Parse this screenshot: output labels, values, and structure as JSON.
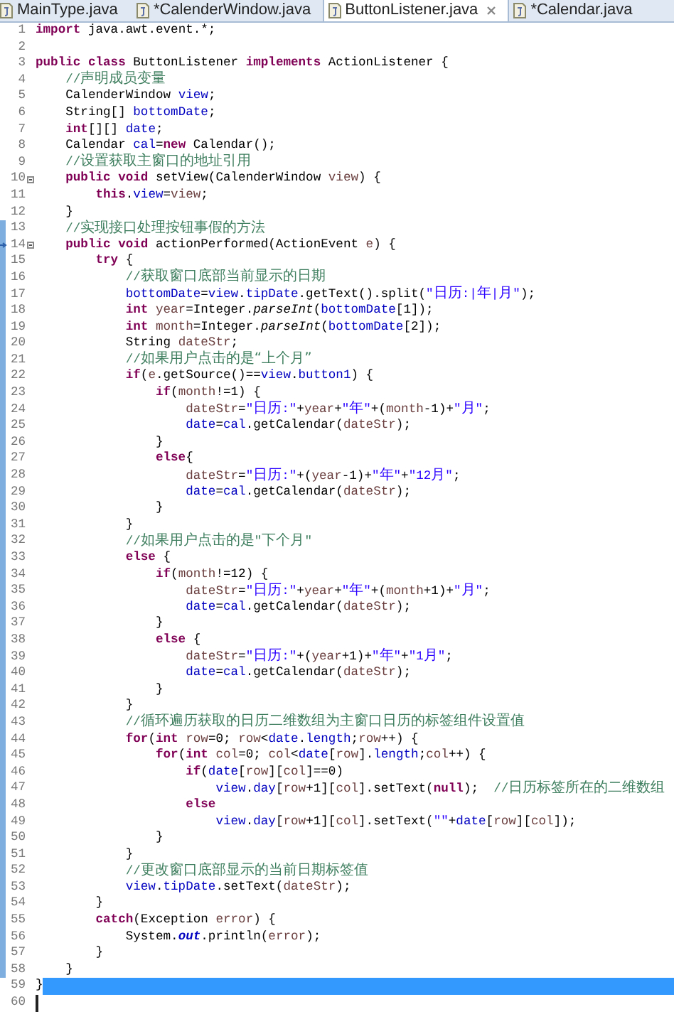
{
  "tabs": [
    {
      "label": "MainType.java",
      "selected": false,
      "closable": false
    },
    {
      "label": "*CalenderWindow.java",
      "selected": false,
      "closable": false
    },
    {
      "label": "ButtonListener.java",
      "selected": true,
      "closable": true
    },
    {
      "label": "*Calendar.java",
      "selected": false,
      "closable": false
    }
  ],
  "lines": [
    {
      "number": "1",
      "kind": "plain",
      "changed": false,
      "selected": false,
      "caret": false,
      "tokens": [
        {
          "kind": "keyword",
          "text": "import"
        },
        {
          "kind": "plain",
          "text": " java.awt.event.*;"
        }
      ]
    },
    {
      "number": "2",
      "kind": "plain",
      "changed": false,
      "selected": false,
      "caret": false
    },
    {
      "number": "3",
      "kind": "plain",
      "changed": false,
      "selected": false,
      "caret": false,
      "tokens": [
        {
          "kind": "keyword",
          "text": "public class"
        },
        {
          "kind": "plain",
          "text": " ButtonListener "
        },
        {
          "kind": "keyword",
          "text": "implements"
        },
        {
          "kind": "plain",
          "text": " ActionListener {"
        }
      ]
    },
    {
      "number": "4",
      "kind": "plain",
      "changed": false,
      "selected": false,
      "caret": false,
      "tokens": [
        {
          "kind": "comment",
          "text": "    //声明成员变量"
        }
      ]
    },
    {
      "number": "5",
      "kind": "plain",
      "changed": false,
      "selected": false,
      "caret": false,
      "tokens": [
        {
          "kind": "plain",
          "text": "    CalenderWindow "
        },
        {
          "kind": "field",
          "text": "view"
        },
        {
          "kind": "plain",
          "text": ";"
        }
      ]
    },
    {
      "number": "6",
      "kind": "plain",
      "changed": false,
      "selected": false,
      "caret": false,
      "tokens": [
        {
          "kind": "plain",
          "text": "    String[] "
        },
        {
          "kind": "field",
          "text": "bottomDate"
        },
        {
          "kind": "plain",
          "text": ";"
        }
      ]
    },
    {
      "number": "7",
      "kind": "plain",
      "changed": false,
      "selected": false,
      "caret": false,
      "tokens": [
        {
          "kind": "keyword",
          "text": "    int"
        },
        {
          "kind": "plain",
          "text": "[][] "
        },
        {
          "kind": "field",
          "text": "date"
        },
        {
          "kind": "plain",
          "text": ";"
        }
      ]
    },
    {
      "number": "8",
      "kind": "plain",
      "changed": false,
      "selected": false,
      "caret": false,
      "tokens": [
        {
          "kind": "plain",
          "text": "    Calendar "
        },
        {
          "kind": "field",
          "text": "cal"
        },
        {
          "kind": "plain",
          "text": "="
        },
        {
          "kind": "keyword",
          "text": "new"
        },
        {
          "kind": "plain",
          "text": " Calendar();"
        }
      ]
    },
    {
      "number": "9",
      "kind": "plain",
      "changed": false,
      "selected": false,
      "caret": false,
      "tokens": [
        {
          "kind": "comment",
          "text": "    //设置获取主窗口的地址引用"
        }
      ]
    },
    {
      "number": "10",
      "kind": "foldable",
      "changed": false,
      "selected": false,
      "caret": false,
      "tokens": [
        {
          "kind": "keyword",
          "text": "    public void"
        },
        {
          "kind": "plain",
          "text": " setView(CalenderWindow "
        },
        {
          "kind": "local",
          "text": "view"
        },
        {
          "kind": "plain",
          "text": ") {"
        }
      ]
    },
    {
      "number": "11",
      "kind": "plain",
      "changed": false,
      "selected": false,
      "caret": false,
      "tokens": [
        {
          "kind": "keyword",
          "text": "        this"
        },
        {
          "kind": "plain",
          "text": "."
        },
        {
          "kind": "field",
          "text": "view"
        },
        {
          "kind": "plain",
          "text": "="
        },
        {
          "kind": "local",
          "text": "view"
        },
        {
          "kind": "plain",
          "text": ";"
        }
      ]
    },
    {
      "number": "12",
      "kind": "plain",
      "changed": false,
      "selected": false,
      "caret": false,
      "tokens": [
        {
          "kind": "plain",
          "text": "    }"
        }
      ]
    },
    {
      "number": "13",
      "kind": "plain",
      "changed": true,
      "selected": false,
      "caret": false,
      "tokens": [
        {
          "kind": "comment",
          "text": "    //实现接口处理按钮事假的方法"
        }
      ]
    },
    {
      "number": "14",
      "kind": "foldable-marked",
      "changed": true,
      "selected": false,
      "caret": false,
      "tokens": [
        {
          "kind": "keyword",
          "text": "    public void"
        },
        {
          "kind": "plain",
          "text": " actionPerformed(ActionEvent "
        },
        {
          "kind": "local",
          "text": "e"
        },
        {
          "kind": "plain",
          "text": ") {"
        }
      ]
    },
    {
      "number": "15",
      "kind": "plain",
      "changed": true,
      "selected": false,
      "caret": false,
      "tokens": [
        {
          "kind": "keyword",
          "text": "        try"
        },
        {
          "kind": "plain",
          "text": " {"
        }
      ]
    },
    {
      "number": "16",
      "kind": "plain",
      "changed": true,
      "selected": false,
      "caret": false,
      "tokens": [
        {
          "kind": "comment",
          "text": "            //获取窗口底部当前显示的日期"
        }
      ]
    },
    {
      "number": "17",
      "kind": "plain",
      "changed": true,
      "selected": false,
      "caret": false,
      "tokens": [
        {
          "kind": "field",
          "text": "            bottomDate"
        },
        {
          "kind": "plain",
          "text": "="
        },
        {
          "kind": "field",
          "text": "view"
        },
        {
          "kind": "plain",
          "text": "."
        },
        {
          "kind": "field",
          "text": "tipDate"
        },
        {
          "kind": "plain",
          "text": ".getText().split("
        },
        {
          "kind": "string",
          "text": "\"日历:|年|月\""
        },
        {
          "kind": "plain",
          "text": ");"
        }
      ]
    },
    {
      "number": "18",
      "kind": "plain",
      "changed": true,
      "selected": false,
      "caret": false,
      "tokens": [
        {
          "kind": "keyword",
          "text": "            int"
        },
        {
          "kind": "local",
          "text": " year"
        },
        {
          "kind": "plain",
          "text": "=Integer."
        },
        {
          "kind": "static-method",
          "text": "parseInt"
        },
        {
          "kind": "plain",
          "text": "("
        },
        {
          "kind": "field",
          "text": "bottomDate"
        },
        {
          "kind": "plain",
          "text": "[1]);"
        }
      ]
    },
    {
      "number": "19",
      "kind": "plain",
      "changed": true,
      "selected": false,
      "caret": false,
      "tokens": [
        {
          "kind": "keyword",
          "text": "            int"
        },
        {
          "kind": "local",
          "text": " month"
        },
        {
          "kind": "plain",
          "text": "=Integer."
        },
        {
          "kind": "static-method",
          "text": "parseInt"
        },
        {
          "kind": "plain",
          "text": "("
        },
        {
          "kind": "field",
          "text": "bottomDate"
        },
        {
          "kind": "plain",
          "text": "[2]);"
        }
      ]
    },
    {
      "number": "20",
      "kind": "plain",
      "changed": true,
      "selected": false,
      "caret": false,
      "tokens": [
        {
          "kind": "plain",
          "text": "            String "
        },
        {
          "kind": "local",
          "text": "dateStr"
        },
        {
          "kind": "plain",
          "text": ";"
        }
      ]
    },
    {
      "number": "21",
      "kind": "plain",
      "changed": true,
      "selected": false,
      "caret": false,
      "tokens": [
        {
          "kind": "comment",
          "text": "            //如果用户点击的是“上个月”"
        }
      ]
    },
    {
      "number": "22",
      "kind": "plain",
      "changed": true,
      "selected": false,
      "caret": false,
      "tokens": [
        {
          "kind": "keyword",
          "text": "            if"
        },
        {
          "kind": "plain",
          "text": "("
        },
        {
          "kind": "local",
          "text": "e"
        },
        {
          "kind": "plain",
          "text": ".getSource()=="
        },
        {
          "kind": "field",
          "text": "view"
        },
        {
          "kind": "plain",
          "text": "."
        },
        {
          "kind": "field",
          "text": "button1"
        },
        {
          "kind": "plain",
          "text": ") {"
        }
      ]
    },
    {
      "number": "23",
      "kind": "plain",
      "changed": true,
      "selected": false,
      "caret": false,
      "tokens": [
        {
          "kind": "keyword",
          "text": "                if"
        },
        {
          "kind": "plain",
          "text": "("
        },
        {
          "kind": "local",
          "text": "month"
        },
        {
          "kind": "plain",
          "text": "!=1) {"
        }
      ]
    },
    {
      "number": "24",
      "kind": "plain",
      "changed": true,
      "selected": false,
      "caret": false,
      "tokens": [
        {
          "kind": "local",
          "text": "                    dateStr"
        },
        {
          "kind": "plain",
          "text": "="
        },
        {
          "kind": "string",
          "text": "\"日历:\""
        },
        {
          "kind": "plain",
          "text": "+"
        },
        {
          "kind": "local",
          "text": "year"
        },
        {
          "kind": "plain",
          "text": "+"
        },
        {
          "kind": "string",
          "text": "\"年\""
        },
        {
          "kind": "plain",
          "text": "+("
        },
        {
          "kind": "local",
          "text": "month"
        },
        {
          "kind": "plain",
          "text": "-1)+"
        },
        {
          "kind": "string",
          "text": "\"月\""
        },
        {
          "kind": "plain",
          "text": ";"
        }
      ]
    },
    {
      "number": "25",
      "kind": "plain",
      "changed": true,
      "selected": false,
      "caret": false,
      "tokens": [
        {
          "kind": "field",
          "text": "                    date"
        },
        {
          "kind": "plain",
          "text": "="
        },
        {
          "kind": "field",
          "text": "cal"
        },
        {
          "kind": "plain",
          "text": ".getCalendar("
        },
        {
          "kind": "local",
          "text": "dateStr"
        },
        {
          "kind": "plain",
          "text": ");"
        }
      ]
    },
    {
      "number": "26",
      "kind": "plain",
      "changed": true,
      "selected": false,
      "caret": false,
      "tokens": [
        {
          "kind": "plain",
          "text": "                }"
        }
      ]
    },
    {
      "number": "27",
      "kind": "plain",
      "changed": true,
      "selected": false,
      "caret": false,
      "tokens": [
        {
          "kind": "keyword",
          "text": "                else"
        },
        {
          "kind": "plain",
          "text": "{"
        }
      ]
    },
    {
      "number": "28",
      "kind": "plain",
      "changed": true,
      "selected": false,
      "caret": false,
      "tokens": [
        {
          "kind": "local",
          "text": "                    dateStr"
        },
        {
          "kind": "plain",
          "text": "="
        },
        {
          "kind": "string",
          "text": "\"日历:\""
        },
        {
          "kind": "plain",
          "text": "+("
        },
        {
          "kind": "local",
          "text": "year"
        },
        {
          "kind": "plain",
          "text": "-1)+"
        },
        {
          "kind": "string",
          "text": "\"年\""
        },
        {
          "kind": "plain",
          "text": "+"
        },
        {
          "kind": "string",
          "text": "\"12月\""
        },
        {
          "kind": "plain",
          "text": ";"
        }
      ]
    },
    {
      "number": "29",
      "kind": "plain",
      "changed": true,
      "selected": false,
      "caret": false,
      "tokens": [
        {
          "kind": "field",
          "text": "                    date"
        },
        {
          "kind": "plain",
          "text": "="
        },
        {
          "kind": "field",
          "text": "cal"
        },
        {
          "kind": "plain",
          "text": ".getCalendar("
        },
        {
          "kind": "local",
          "text": "dateStr"
        },
        {
          "kind": "plain",
          "text": ");"
        }
      ]
    },
    {
      "number": "30",
      "kind": "plain",
      "changed": true,
      "selected": false,
      "caret": false,
      "tokens": [
        {
          "kind": "plain",
          "text": "                }"
        }
      ]
    },
    {
      "number": "31",
      "kind": "plain",
      "changed": true,
      "selected": false,
      "caret": false,
      "tokens": [
        {
          "kind": "plain",
          "text": "            }"
        }
      ]
    },
    {
      "number": "32",
      "kind": "plain",
      "changed": true,
      "selected": false,
      "caret": false,
      "tokens": [
        {
          "kind": "comment",
          "text": "            //如果用户点击的是\"下个月\""
        }
      ]
    },
    {
      "number": "33",
      "kind": "plain",
      "changed": true,
      "selected": false,
      "caret": false,
      "tokens": [
        {
          "kind": "keyword",
          "text": "            else"
        },
        {
          "kind": "plain",
          "text": " {"
        }
      ]
    },
    {
      "number": "34",
      "kind": "plain",
      "changed": true,
      "selected": false,
      "caret": false,
      "tokens": [
        {
          "kind": "keyword",
          "text": "                if"
        },
        {
          "kind": "plain",
          "text": "("
        },
        {
          "kind": "local",
          "text": "month"
        },
        {
          "kind": "plain",
          "text": "!=12) {"
        }
      ]
    },
    {
      "number": "35",
      "kind": "plain",
      "changed": true,
      "selected": false,
      "caret": false,
      "tokens": [
        {
          "kind": "local",
          "text": "                    dateStr"
        },
        {
          "kind": "plain",
          "text": "="
        },
        {
          "kind": "string",
          "text": "\"日历:\""
        },
        {
          "kind": "plain",
          "text": "+"
        },
        {
          "kind": "local",
          "text": "year"
        },
        {
          "kind": "plain",
          "text": "+"
        },
        {
          "kind": "string",
          "text": "\"年\""
        },
        {
          "kind": "plain",
          "text": "+("
        },
        {
          "kind": "local",
          "text": "month"
        },
        {
          "kind": "plain",
          "text": "+1)+"
        },
        {
          "kind": "string",
          "text": "\"月\""
        },
        {
          "kind": "plain",
          "text": ";"
        }
      ]
    },
    {
      "number": "36",
      "kind": "plain",
      "changed": true,
      "selected": false,
      "caret": false,
      "tokens": [
        {
          "kind": "field",
          "text": "                    date"
        },
        {
          "kind": "plain",
          "text": "="
        },
        {
          "kind": "field",
          "text": "cal"
        },
        {
          "kind": "plain",
          "text": ".getCalendar("
        },
        {
          "kind": "local",
          "text": "dateStr"
        },
        {
          "kind": "plain",
          "text": ");"
        }
      ]
    },
    {
      "number": "37",
      "kind": "plain",
      "changed": true,
      "selected": false,
      "caret": false,
      "tokens": [
        {
          "kind": "plain",
          "text": "                }"
        }
      ]
    },
    {
      "number": "38",
      "kind": "plain",
      "changed": true,
      "selected": false,
      "caret": false,
      "tokens": [
        {
          "kind": "keyword",
          "text": "                else"
        },
        {
          "kind": "plain",
          "text": " {"
        }
      ]
    },
    {
      "number": "39",
      "kind": "plain",
      "changed": true,
      "selected": false,
      "caret": false,
      "tokens": [
        {
          "kind": "local",
          "text": "                    dateStr"
        },
        {
          "kind": "plain",
          "text": "="
        },
        {
          "kind": "string",
          "text": "\"日历:\""
        },
        {
          "kind": "plain",
          "text": "+("
        },
        {
          "kind": "local",
          "text": "year"
        },
        {
          "kind": "plain",
          "text": "+1)+"
        },
        {
          "kind": "string",
          "text": "\"年\""
        },
        {
          "kind": "plain",
          "text": "+"
        },
        {
          "kind": "string",
          "text": "\"1月\""
        },
        {
          "kind": "plain",
          "text": ";"
        }
      ]
    },
    {
      "number": "40",
      "kind": "plain",
      "changed": true,
      "selected": false,
      "caret": false,
      "tokens": [
        {
          "kind": "field",
          "text": "                    date"
        },
        {
          "kind": "plain",
          "text": "="
        },
        {
          "kind": "field",
          "text": "cal"
        },
        {
          "kind": "plain",
          "text": ".getCalendar("
        },
        {
          "kind": "local",
          "text": "dateStr"
        },
        {
          "kind": "plain",
          "text": ");"
        }
      ]
    },
    {
      "number": "41",
      "kind": "plain",
      "changed": true,
      "selected": false,
      "caret": false,
      "tokens": [
        {
          "kind": "plain",
          "text": "                }"
        }
      ]
    },
    {
      "number": "42",
      "kind": "plain",
      "changed": true,
      "selected": false,
      "caret": false,
      "tokens": [
        {
          "kind": "plain",
          "text": "            }"
        }
      ]
    },
    {
      "number": "43",
      "kind": "plain",
      "changed": true,
      "selected": false,
      "caret": false,
      "tokens": [
        {
          "kind": "comment",
          "text": "            //循环遍历获取的日历二维数组为主窗口日历的标签组件设置值"
        }
      ]
    },
    {
      "number": "44",
      "kind": "plain",
      "changed": true,
      "selected": false,
      "caret": false,
      "tokens": [
        {
          "kind": "keyword",
          "text": "            for"
        },
        {
          "kind": "plain",
          "text": "("
        },
        {
          "kind": "keyword",
          "text": "int"
        },
        {
          "kind": "local",
          "text": " row"
        },
        {
          "kind": "plain",
          "text": "=0; "
        },
        {
          "kind": "local",
          "text": "row"
        },
        {
          "kind": "plain",
          "text": "<"
        },
        {
          "kind": "field",
          "text": "date"
        },
        {
          "kind": "plain",
          "text": "."
        },
        {
          "kind": "field",
          "text": "length"
        },
        {
          "kind": "plain",
          "text": ";"
        },
        {
          "kind": "local",
          "text": "row"
        },
        {
          "kind": "plain",
          "text": "++) {"
        }
      ]
    },
    {
      "number": "45",
      "kind": "plain",
      "changed": true,
      "selected": false,
      "caret": false,
      "tokens": [
        {
          "kind": "keyword",
          "text": "                for"
        },
        {
          "kind": "plain",
          "text": "("
        },
        {
          "kind": "keyword",
          "text": "int"
        },
        {
          "kind": "local",
          "text": " col"
        },
        {
          "kind": "plain",
          "text": "=0; "
        },
        {
          "kind": "local",
          "text": "col"
        },
        {
          "kind": "plain",
          "text": "<"
        },
        {
          "kind": "field",
          "text": "date"
        },
        {
          "kind": "plain",
          "text": "["
        },
        {
          "kind": "local",
          "text": "row"
        },
        {
          "kind": "plain",
          "text": "]."
        },
        {
          "kind": "field",
          "text": "length"
        },
        {
          "kind": "plain",
          "text": ";"
        },
        {
          "kind": "local",
          "text": "col"
        },
        {
          "kind": "plain",
          "text": "++) {"
        }
      ]
    },
    {
      "number": "46",
      "kind": "plain",
      "changed": true,
      "selected": false,
      "caret": false,
      "tokens": [
        {
          "kind": "keyword",
          "text": "                    if"
        },
        {
          "kind": "plain",
          "text": "("
        },
        {
          "kind": "field",
          "text": "date"
        },
        {
          "kind": "plain",
          "text": "["
        },
        {
          "kind": "local",
          "text": "row"
        },
        {
          "kind": "plain",
          "text": "]["
        },
        {
          "kind": "local",
          "text": "col"
        },
        {
          "kind": "plain",
          "text": "]==0)"
        }
      ]
    },
    {
      "number": "47",
      "kind": "plain",
      "changed": true,
      "selected": false,
      "caret": false,
      "tokens": [
        {
          "kind": "field",
          "text": "                        view"
        },
        {
          "kind": "plain",
          "text": "."
        },
        {
          "kind": "field",
          "text": "day"
        },
        {
          "kind": "plain",
          "text": "["
        },
        {
          "kind": "local",
          "text": "row"
        },
        {
          "kind": "plain",
          "text": "+1]["
        },
        {
          "kind": "local",
          "text": "col"
        },
        {
          "kind": "plain",
          "text": "].setText("
        },
        {
          "kind": "keyword",
          "text": "null"
        },
        {
          "kind": "plain",
          "text": ");"
        },
        {
          "kind": "comment",
          "text": "  //日历标签所在的二维数组"
        }
      ]
    },
    {
      "number": "48",
      "kind": "plain",
      "changed": true,
      "selected": false,
      "caret": false,
      "tokens": [
        {
          "kind": "keyword",
          "text": "                    else"
        }
      ]
    },
    {
      "number": "49",
      "kind": "plain",
      "changed": true,
      "selected": false,
      "caret": false,
      "tokens": [
        {
          "kind": "field",
          "text": "                        view"
        },
        {
          "kind": "plain",
          "text": "."
        },
        {
          "kind": "field",
          "text": "day"
        },
        {
          "kind": "plain",
          "text": "["
        },
        {
          "kind": "local",
          "text": "row"
        },
        {
          "kind": "plain",
          "text": "+1]["
        },
        {
          "kind": "local",
          "text": "col"
        },
        {
          "kind": "plain",
          "text": "].setText("
        },
        {
          "kind": "string",
          "text": "\"\""
        },
        {
          "kind": "plain",
          "text": "+"
        },
        {
          "kind": "field",
          "text": "date"
        },
        {
          "kind": "plain",
          "text": "["
        },
        {
          "kind": "local",
          "text": "row"
        },
        {
          "kind": "plain",
          "text": "]["
        },
        {
          "kind": "local",
          "text": "col"
        },
        {
          "kind": "plain",
          "text": "]);"
        }
      ]
    },
    {
      "number": "50",
      "kind": "plain",
      "changed": true,
      "selected": false,
      "caret": false,
      "tokens": [
        {
          "kind": "plain",
          "text": "                }"
        }
      ]
    },
    {
      "number": "51",
      "kind": "plain",
      "changed": true,
      "selected": false,
      "caret": false,
      "tokens": [
        {
          "kind": "plain",
          "text": "            }"
        }
      ]
    },
    {
      "number": "52",
      "kind": "plain",
      "changed": true,
      "selected": false,
      "caret": false,
      "tokens": [
        {
          "kind": "comment",
          "text": "            //更改窗口底部显示的当前日期标签值"
        }
      ]
    },
    {
      "number": "53",
      "kind": "plain",
      "changed": true,
      "selected": false,
      "caret": false,
      "tokens": [
        {
          "kind": "field",
          "text": "            view"
        },
        {
          "kind": "plain",
          "text": "."
        },
        {
          "kind": "field",
          "text": "tipDate"
        },
        {
          "kind": "plain",
          "text": ".setText("
        },
        {
          "kind": "local",
          "text": "dateStr"
        },
        {
          "kind": "plain",
          "text": ");"
        }
      ]
    },
    {
      "number": "54",
      "kind": "plain",
      "changed": true,
      "selected": false,
      "caret": false,
      "tokens": [
        {
          "kind": "plain",
          "text": "        }"
        }
      ]
    },
    {
      "number": "55",
      "kind": "plain",
      "changed": true,
      "selected": false,
      "caret": false,
      "tokens": [
        {
          "kind": "keyword",
          "text": "        catch"
        },
        {
          "kind": "plain",
          "text": "(Exception "
        },
        {
          "kind": "local",
          "text": "error"
        },
        {
          "kind": "plain",
          "text": ") {"
        }
      ]
    },
    {
      "number": "56",
      "kind": "plain",
      "changed": true,
      "selected": false,
      "caret": false,
      "tokens": [
        {
          "kind": "plain",
          "text": "            System."
        },
        {
          "kind": "static-field",
          "text": "out"
        },
        {
          "kind": "plain",
          "text": ".println("
        },
        {
          "kind": "local",
          "text": "error"
        },
        {
          "kind": "plain",
          "text": ");"
        }
      ]
    },
    {
      "number": "57",
      "kind": "plain",
      "changed": true,
      "selected": false,
      "caret": false,
      "tokens": [
        {
          "kind": "plain",
          "text": "        }"
        }
      ]
    },
    {
      "number": "58",
      "kind": "plain",
      "changed": true,
      "selected": false,
      "caret": false,
      "tokens": [
        {
          "kind": "plain",
          "text": "    }"
        }
      ]
    },
    {
      "number": "59",
      "kind": "plain",
      "changed": false,
      "selected": true,
      "caret": false,
      "tokens": [
        {
          "kind": "plain",
          "text": "}"
        }
      ]
    },
    {
      "number": "60",
      "kind": "plain",
      "changed": false,
      "selected": false,
      "caret": true
    }
  ]
}
